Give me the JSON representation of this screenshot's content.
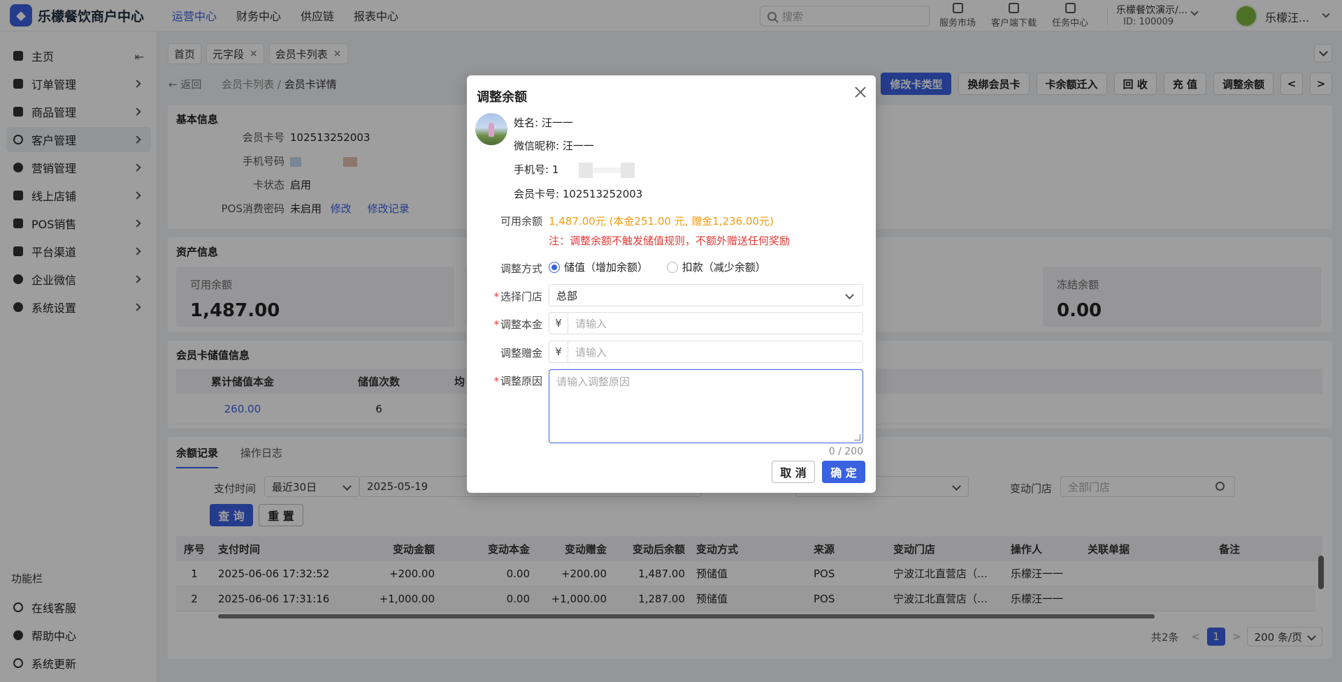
{
  "header": {
    "logo_glyph": "◆",
    "app_title": "乐檬餐饮商户中心",
    "nav": [
      "运营中心",
      "财务中心",
      "供应链",
      "报表中心"
    ],
    "search_placeholder": "搜索",
    "tools": [
      "服务市场",
      "客户端下载",
      "任务中心"
    ],
    "shop_name": "乐檬餐饮演示/...",
    "shop_id": "ID: 100009",
    "user_name": "乐檬汪..."
  },
  "sidebar": {
    "collapse_glyph": "⇤",
    "items": [
      "主页",
      "订单管理",
      "商品管理",
      "客户管理",
      "营销管理",
      "线上店铺",
      "POS销售",
      "平台渠道",
      "企业微信",
      "系统设置"
    ],
    "section_title": "功能栏",
    "bottom_items": [
      "在线客服",
      "帮助中心",
      "系统更新"
    ]
  },
  "tabs": {
    "items": [
      "首页",
      "元字段",
      "会员卡列表"
    ],
    "close_glyph": "×"
  },
  "breadcrumb": {
    "back": "← 返回",
    "parent": "会员卡列表",
    "sep": "/",
    "current": "会员卡详情"
  },
  "actions": {
    "modify_type": "修改卡类型",
    "rebind": "换绑会员卡",
    "transfer": "卡余额迁入",
    "recycle": "回 收",
    "recharge": "充 值",
    "adjust": "调整余额",
    "prev": "<",
    "next": ">"
  },
  "basic_info": {
    "title": "基本信息",
    "card_no_label": "会员卡号",
    "card_no": "102513252003",
    "phone_label": "手机号码",
    "status_label": "卡状态",
    "status": "启用",
    "pos_pwd_label": "POS消费密码",
    "pos_pwd": "未启用",
    "modify_link": "修改",
    "modify_record_link": "修改记录"
  },
  "assets": {
    "title": "资产信息",
    "available_label": "可用余额",
    "available_value": "1,487.00",
    "frozen_label": "冻结余额",
    "frozen_value": "0.00"
  },
  "stored_info": {
    "title": "会员卡储值信息",
    "col_principal": "累计储值本金",
    "col_count": "储值次数",
    "col_partial": "均",
    "principal": "260.00",
    "count": "6"
  },
  "records": {
    "tab_balance": "余额记录",
    "tab_log": "操作日志",
    "pay_time_label": "支付时间",
    "range_value": "最近30日",
    "date_value": "2025-05-19",
    "store_label": "变动门店",
    "store_placeholder": "全部门店",
    "query_btn": "查 询",
    "reset_btn": "重 置",
    "columns": [
      "序号",
      "支付时间",
      "变动金额",
      "变动本金",
      "变动赠金",
      "变动后余额",
      "变动方式",
      "来源",
      "变动门店",
      "操作人",
      "关联单据",
      "备注"
    ],
    "rows": [
      [
        "1",
        "2025-06-06 17:32:52",
        "+200.00",
        "0.00",
        "+200.00",
        "1,487.00",
        "预储值",
        "POS",
        "宁波江北直营店（…",
        "乐檬汪一一",
        "",
        ""
      ],
      [
        "2",
        "2025-06-06 17:31:16",
        "+1,000.00",
        "0.00",
        "+1,000.00",
        "1,287.00",
        "预储值",
        "POS",
        "宁波江北直营店（…",
        "乐檬汪一一",
        "",
        ""
      ]
    ],
    "total": "共2条",
    "page_prev": "<",
    "page": "1",
    "page_next": ">",
    "page_size": "200 条/页"
  },
  "modal": {
    "title": "调整余额",
    "name": "姓名: 汪一一",
    "wechat": "微信昵称: 汪一一",
    "phone": "手机号: 1",
    "card_no": "会员卡号: 102513252003",
    "available_label": "可用余额",
    "available_value": "1,487.00元 (本金251.00 元, 赠金1,236.00元)",
    "note": "注：调整余额不触发储值规则，不额外赠送任何奖励",
    "method_label": "调整方式",
    "method_add": "储值（增加余额）",
    "method_sub": "扣款（减少余额）",
    "store_label": "选择门店",
    "store_value": "总部",
    "principal_label": "调整本金",
    "gift_label": "调整赠金",
    "currency": "¥",
    "input_placeholder": "请输入",
    "reason_label": "调整原因",
    "reason_placeholder": "请输入调整原因",
    "required_mark": "*",
    "count": "0 / 200",
    "cancel": "取 消",
    "confirm": "确 定"
  }
}
